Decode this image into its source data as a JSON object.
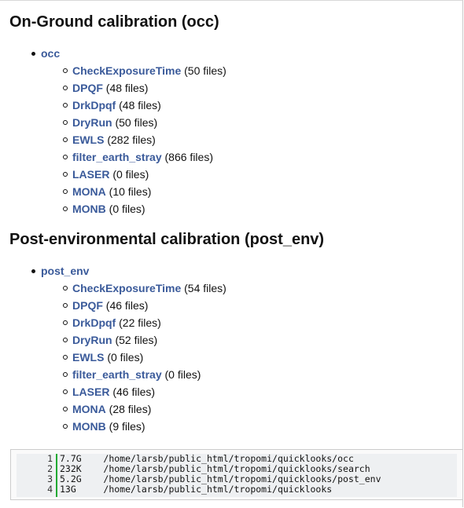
{
  "sections": [
    {
      "title": "On-Ground calibration (occ)",
      "group": {
        "label": "occ",
        "items": [
          {
            "name": "CheckExposureTime",
            "count": "(50 files)"
          },
          {
            "name": "DPQF",
            "count": "(48 files)"
          },
          {
            "name": "DrkDpqf",
            "count": "(48 files)"
          },
          {
            "name": "DryRun",
            "count": "(50 files)"
          },
          {
            "name": "EWLS",
            "count": "(282 files)"
          },
          {
            "name": "filter_earth_stray",
            "count": "(866 files)"
          },
          {
            "name": "LASER",
            "count": "(0 files)"
          },
          {
            "name": "MONA",
            "count": "(10 files)"
          },
          {
            "name": "MONB",
            "count": "(0 files)"
          }
        ]
      }
    },
    {
      "title": "Post-environmental calibration (post_env)",
      "group": {
        "label": "post_env",
        "items": [
          {
            "name": "CheckExposureTime",
            "count": "(54 files)"
          },
          {
            "name": "DPQF",
            "count": "(46 files)"
          },
          {
            "name": "DrkDpqf",
            "count": "(22 files)"
          },
          {
            "name": "DryRun",
            "count": "(52 files)"
          },
          {
            "name": "EWLS",
            "count": "(0 files)"
          },
          {
            "name": "filter_earth_stray",
            "count": "(0 files)"
          },
          {
            "name": "LASER",
            "count": "(46 files)"
          },
          {
            "name": "MONA",
            "count": "(28 files)"
          },
          {
            "name": "MONB",
            "count": "(9 files)"
          }
        ]
      }
    }
  ],
  "code": {
    "lines": [
      {
        "num": "1",
        "text": "7.7G\t/home/larsb/public_html/tropomi/quicklooks/occ"
      },
      {
        "num": "2",
        "text": "232K\t/home/larsb/public_html/tropomi/quicklooks/search"
      },
      {
        "num": "3",
        "text": "5.2G\t/home/larsb/public_html/tropomi/quicklooks/post_env"
      },
      {
        "num": "4",
        "text": "13G\t/home/larsb/public_html/tropomi/quicklooks"
      }
    ]
  },
  "colors": {
    "link": "#3a5a9a",
    "gutter_border": "#22aa33"
  }
}
